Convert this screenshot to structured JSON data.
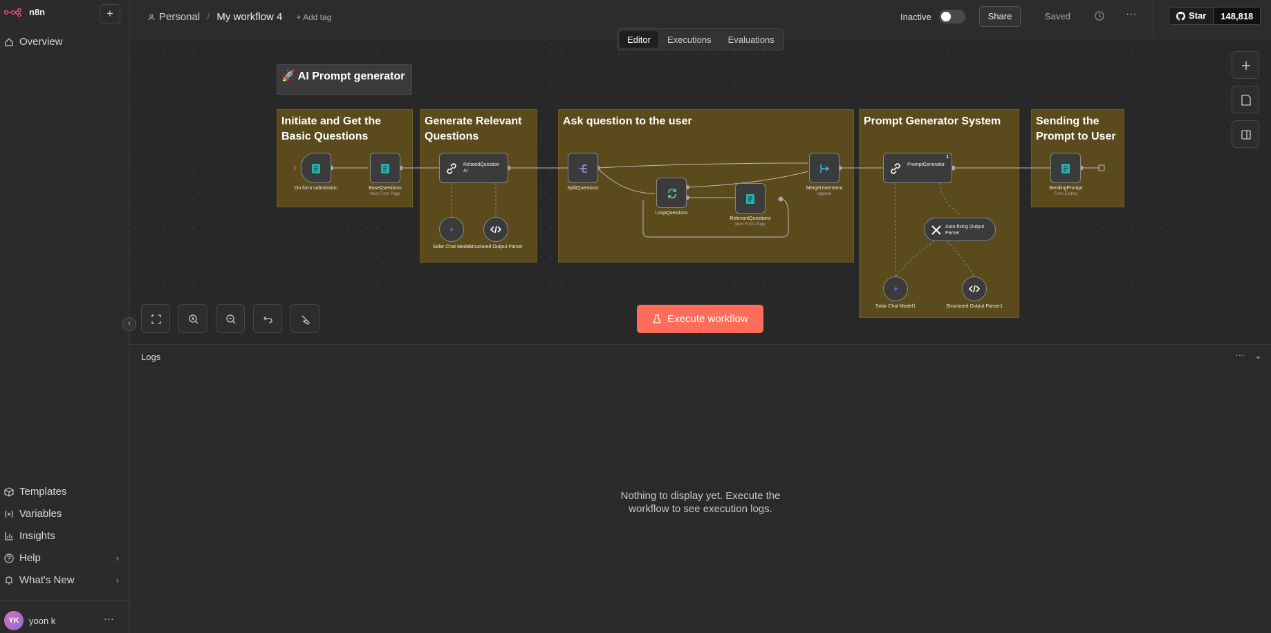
{
  "sidebar": {
    "logo": "n8n",
    "items_top": [
      {
        "label": "Overview",
        "icon": "home-icon"
      }
    ],
    "items_bottom": [
      {
        "label": "Templates",
        "icon": "box-icon"
      },
      {
        "label": "Variables",
        "icon": "variable-icon"
      },
      {
        "label": "Insights",
        "icon": "chart-icon"
      },
      {
        "label": "Help",
        "icon": "help-icon"
      },
      {
        "label": "What's New",
        "icon": "bell-icon"
      }
    ],
    "user": {
      "initials": "YK",
      "name": "yoon k"
    }
  },
  "header": {
    "project": "Personal",
    "workflow_name": "My workflow 4",
    "add_tag": "+ Add tag",
    "status": "Inactive",
    "share": "Share",
    "saved": "Saved",
    "github_star": "Star",
    "github_count": "148,818"
  },
  "tabs": [
    "Editor",
    "Executions",
    "Evaluations"
  ],
  "canvas": {
    "title_note": "🚀 AI Prompt generator",
    "sections": [
      "Initiate and Get the Basic Questions",
      "Generate Relevant Questions",
      "Ask question to the user",
      "Prompt Generator System",
      "Sending the Prompt to User"
    ],
    "nodes": {
      "form": "On form submission",
      "base": "BaseQuestions",
      "base_sub": "Next Form Page",
      "related": "RelatedQuestion AI",
      "split": "SplitQuestions",
      "loop": "LoopQuestions",
      "relevant": "RelevantQuestions",
      "relevant_sub": "Next Form Page",
      "merge": "MergeUserIntent",
      "merge_sub": "append",
      "prompt": "PromptGenerator",
      "prompt_badge": "1",
      "sending": "SendingPrompt",
      "sending_sub": "Form Ending",
      "solar1": "Solar Chat Model",
      "parser1": "Structured Output Parser",
      "autofix": "Auto-fixing Output Parser",
      "solar2": "Solar Chat Model1",
      "parser2": "Structured Output Parser1"
    },
    "execute": "Execute workflow"
  },
  "logs": {
    "title": "Logs",
    "empty": "Nothing to display yet. Execute the workflow to see execution logs."
  }
}
